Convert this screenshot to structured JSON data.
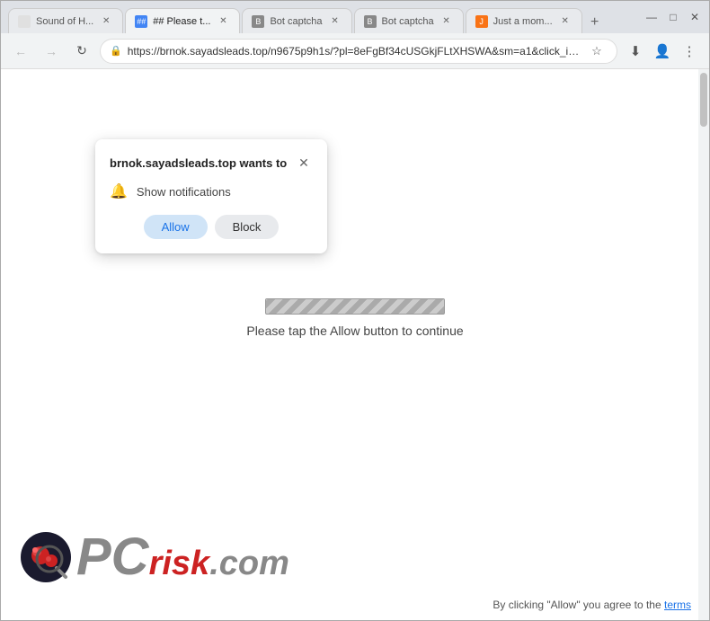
{
  "browser": {
    "tabs": [
      {
        "id": "tab1",
        "title": "Sound of H...",
        "active": false,
        "favicon": "sound"
      },
      {
        "id": "tab2",
        "title": "## Please t...",
        "active": true,
        "favicon": "hash"
      },
      {
        "id": "tab3",
        "title": "Bot captcha",
        "active": false,
        "favicon": "bot"
      },
      {
        "id": "tab4",
        "title": "Bot captcha",
        "active": false,
        "favicon": "bot2"
      },
      {
        "id": "tab5",
        "title": "Just a mom...",
        "active": false,
        "favicon": "just"
      }
    ],
    "url": "https://brnok.sayadsleads.top/n9675p9h1s/?pl=8eFgBf34cUSGkjFLtXHSWA&sm=a1&click_id=c5...",
    "window_controls": {
      "minimize": "—",
      "maximize": "□",
      "close": "✕"
    }
  },
  "popup": {
    "domain": "brnok.sayadsleads.top",
    "wants_to": "wants to",
    "permission": "Show notifications",
    "allow_label": "Allow",
    "block_label": "Block",
    "close_label": "✕"
  },
  "page": {
    "instruction": "Please tap the Allow button to continue"
  },
  "logo": {
    "pc": "PC",
    "risk": "risk",
    "dotcom": ".com"
  },
  "disclaimer": {
    "text": "By clicking \"Allow\" you agree to the",
    "link_text": "terms"
  },
  "icons": {
    "back": "←",
    "forward": "→",
    "reload": "↻",
    "bookmark": "☆",
    "download": "⬇",
    "profile": "👤",
    "menu": "⋮",
    "lock": "🔒"
  }
}
